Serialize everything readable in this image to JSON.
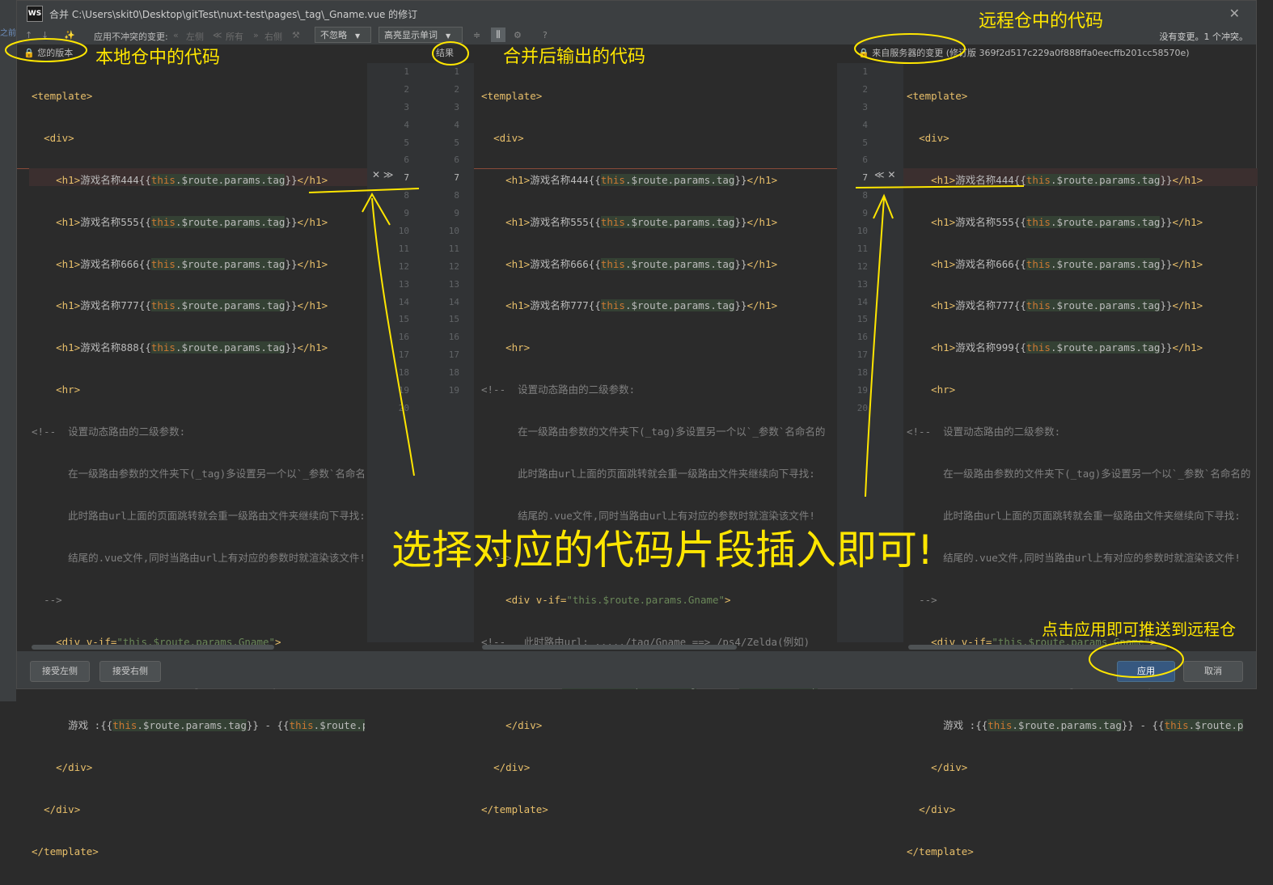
{
  "window": {
    "logo": "WS",
    "title": "合并 C:\\Users\\skit0\\Desktop\\gitTest\\nuxt-test\\pages\\_tag\\_Gname.vue 的修订",
    "close": "✕"
  },
  "toolbar": {
    "apply_nonconflict": "应用不冲突的变更:",
    "left": "左侧",
    "all": "所有",
    "right": "右侧",
    "ignore_select": "不忽略",
    "highlight_select": "高亮显示单词",
    "help": "?",
    "status": "没有变更。1 个冲突。"
  },
  "left_strip_text": "之前",
  "panes": {
    "left_header": "您的版本",
    "middle_header": "结果",
    "right_header": "来自服务器的变更",
    "right_revision": "(修订版 369f2d517c229a0f888ffa0eecffb201cc58570e)"
  },
  "line_numbers": [
    "1",
    "2",
    "3",
    "4",
    "5",
    "6",
    "7",
    "8",
    "9",
    "10",
    "11",
    "12",
    "13",
    "14",
    "15",
    "16",
    "17",
    "18",
    "19",
    "20"
  ],
  "mid_line_numbers": [
    "1",
    "2",
    "3",
    "4",
    "5",
    "6",
    "7",
    "8",
    "9",
    "10",
    "11",
    "12",
    "13",
    "14",
    "15",
    "16",
    "17",
    "18",
    "19"
  ],
  "code": {
    "template_open": "<template>",
    "div_open": "<div>",
    "div_close": "</div>",
    "template_close": "</template>",
    "h1_open": "<h1>",
    "h1_close": "</h1>",
    "hr": "<hr>",
    "name444": "游戏名称444",
    "name555": "游戏名称555",
    "name666": "游戏名称666",
    "name777": "游戏名称777",
    "name888": "游戏名称888",
    "name999": "游戏名称999",
    "brace_open": "{{",
    "brace_close": "}}",
    "this": "this",
    "route_tag": ".$route.params.tag",
    "comment_open": "<!--",
    "comment_line1": "  设置动态路由的二级参数:",
    "comment_line2": "在一级路由参数的文件夹下(_tag)多设置另一个以`_参数`名命名的",
    "comment_line3": "此时路由url上面的页面跳转就会重一级路由文件夹继续向下寻找:",
    "comment_line4": "结尾的.vue文件,同时当路由url上有对应的参数时就渲染该文件!",
    "comment_close": "-->",
    "div_vif_open": "<div v-if=",
    "vif_value": "\"this.$route.params.Gname\"",
    "gt": ">",
    "comment_url": "<!--   此时路由url: ...../tag/Gname ==> /ps4/Zelda(例如)",
    "game_prefix": "游戏 :",
    "dash": " - ",
    "route_p": ".$route.p"
  },
  "conflict_markers": {
    "left": "✕ ≫",
    "right": "≪ ✕",
    "line": "7"
  },
  "buttons": {
    "accept_left": "接受左侧",
    "accept_right": "接受右侧",
    "apply": "应用",
    "cancel": "取消"
  },
  "annotations": {
    "local_code": "本地仓中的代码",
    "merged_output": "合并后输出的代码",
    "remote_code": "远程仓中的代码",
    "select_hint": "选择对应的代码片段插入即可!",
    "apply_hint": "点击应用即可推送到远程仓"
  }
}
